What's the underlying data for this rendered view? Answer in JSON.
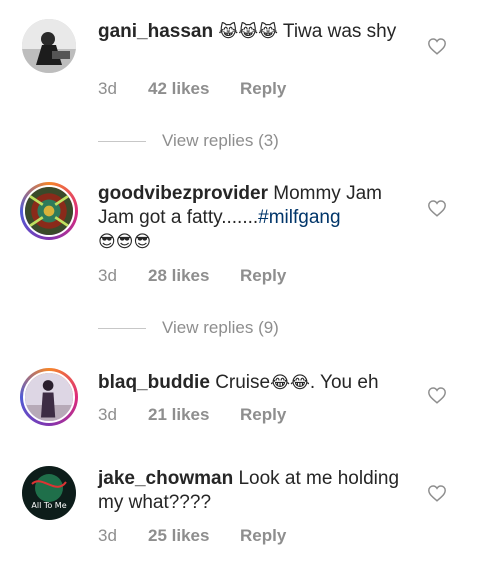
{
  "comments": [
    {
      "username": "gani_hassan",
      "text": "Tiwa was shy",
      "emojis": "😹😹😹",
      "time": "3d",
      "likes": "42 likes",
      "reply": "Reply",
      "avatar_ring": false
    },
    {
      "username": "goodvibezprovider",
      "text": "Mommy Jam Jam  got a fatty.......",
      "hashtag": "#milfgang",
      "emojis": "😎😎😎",
      "time": "3d",
      "likes": "28 likes",
      "reply": "Reply",
      "avatar_ring": true
    },
    {
      "username": "blaq_buddie",
      "text": "Cruise",
      "emojis": "😂😂",
      "text_after": ". You eh",
      "time": "3d",
      "likes": "21 likes",
      "reply": "Reply",
      "avatar_ring": true
    },
    {
      "username": "jake_chowman",
      "text": "Look at me holding my what????",
      "time": "3d",
      "likes": "25 likes",
      "reply": "Reply",
      "avatar_ring": false,
      "avatar_text": "All To Me"
    }
  ],
  "view_replies": [
    "View replies (3)",
    "View replies (9)"
  ],
  "colors": {
    "muted": "#8e8e8e",
    "hashtag": "#003569",
    "text": "#262626"
  }
}
